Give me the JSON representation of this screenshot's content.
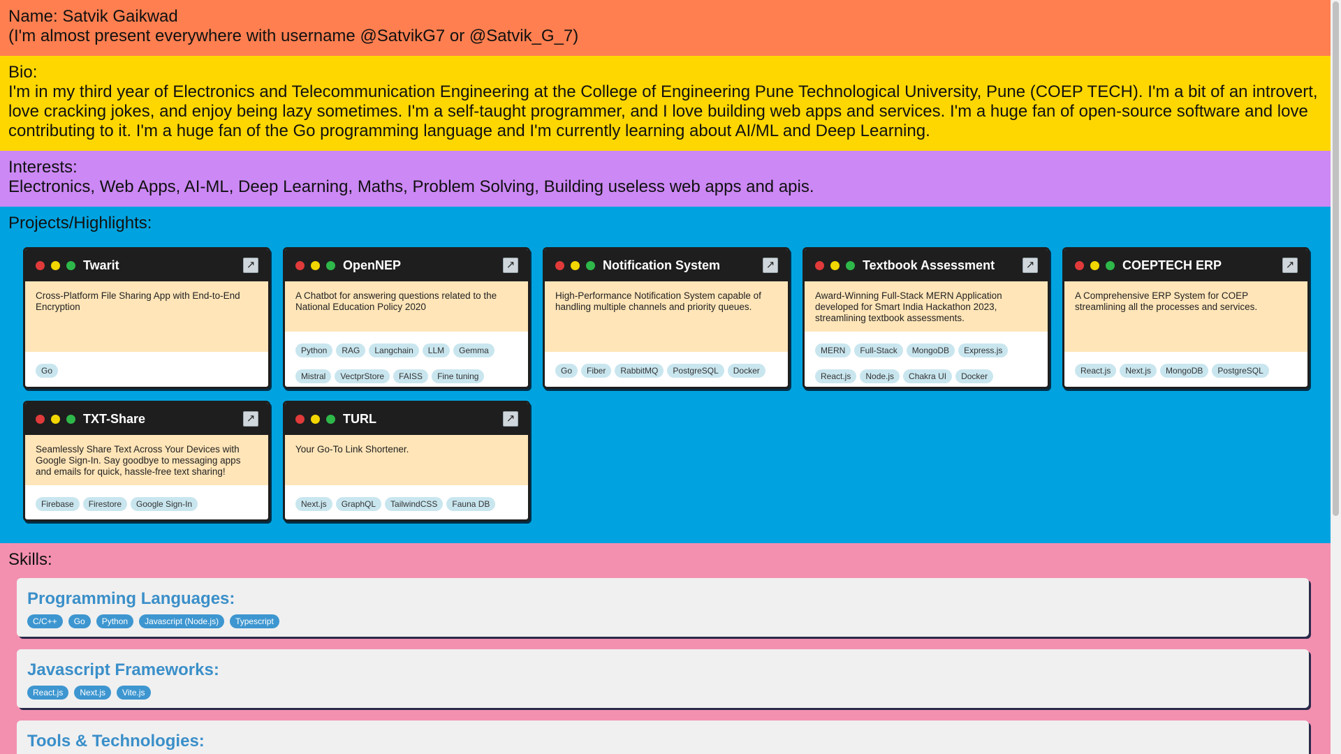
{
  "header": {
    "name_line": "Name: Satvik Gaikwad",
    "username_line": "(I'm almost present everywhere with username @SatvikG7 or @Satvik_G_7)"
  },
  "bio": {
    "label": "Bio:",
    "text": "I'm in my third year of Electronics and Telecommunication Engineering at the College of Engineering Pune Technological University, Pune (COEP TECH). I'm a bit of an introvert, love cracking jokes, and enjoy being lazy sometimes. I'm a self-taught programmer, and I love building web apps and services. I'm a huge fan of open-source software and love contributing to it. I'm a huge fan of the Go programming language and I'm currently learning about AI/ML and Deep Learning."
  },
  "interests": {
    "label": "Interests:",
    "text": "Electronics, Web Apps, AI-ML, Deep Learning, Maths, Problem Solving, Building useless web apps and apis."
  },
  "projects": {
    "label": "Projects/Highlights:",
    "open_icon": "↗",
    "items": [
      {
        "title": "Twarit",
        "description": "Cross-Platform File Sharing App with End-to-End Encryption",
        "tags": [
          "Go"
        ]
      },
      {
        "title": "OpenNEP",
        "description": "A Chatbot for answering questions related to the National Education Policy 2020",
        "tags": [
          "Python",
          "RAG",
          "Langchain",
          "LLM",
          "Gemma",
          "Mistral",
          "VectprStore",
          "FAISS",
          "Fine tuning"
        ]
      },
      {
        "title": "Notification System",
        "description": "High-Performance Notification System capable of handling multiple channels and priority queues.",
        "tags": [
          "Go",
          "Fiber",
          "RabbitMQ",
          "PostgreSQL",
          "Docker"
        ]
      },
      {
        "title": "Textbook Assessment",
        "description": "Award-Winning Full-Stack MERN Application developed for Smart India Hackathon 2023, streamlining textbook assessments.",
        "tags": [
          "MERN",
          "Full-Stack",
          "MongoDB",
          "Express.js",
          "React.js",
          "Node.js",
          "Chakra UI",
          "Docker"
        ]
      },
      {
        "title": "COEPTECH ERP",
        "description": "A Comprehensive ERP System for COEP streamlining all the processes and services.",
        "tags": [
          "React.js",
          "Next.js",
          "MongoDB",
          "PostgreSQL"
        ]
      },
      {
        "title": "TXT-Share",
        "description": "Seamlessly Share Text Across Your Devices with Google Sign-In. Say goodbye to messaging apps and emails for quick, hassle-free text sharing!",
        "tags": [
          "Firebase",
          "Firestore",
          "Google Sign-In"
        ]
      },
      {
        "title": "TURL",
        "description": "Your Go-To Link Shortener.",
        "tags": [
          "Next.js",
          "GraphQL",
          "TailwindCSS",
          "Fauna DB"
        ]
      }
    ]
  },
  "skills": {
    "label": "Skills:",
    "groups": [
      {
        "title": "Programming Languages:",
        "tags": [
          "C/C++",
          "Go",
          "Python",
          "Javascript (Node.js)",
          "Typescript"
        ]
      },
      {
        "title": "Javascript Frameworks:",
        "tags": [
          "React.js",
          "Next.js",
          "Vite.js"
        ]
      },
      {
        "title": "Tools & Technologies:",
        "tags": []
      }
    ]
  }
}
